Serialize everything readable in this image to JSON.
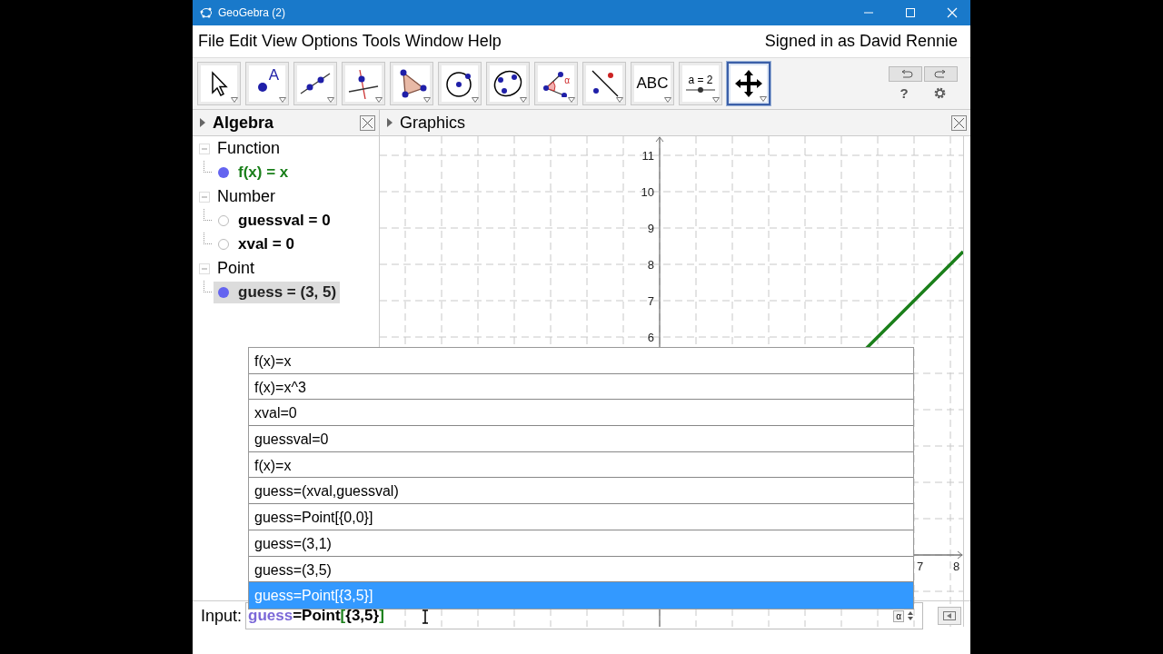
{
  "window": {
    "title": "GeoGebra (2)"
  },
  "menu": [
    "File",
    "Edit",
    "View",
    "Options",
    "Tools",
    "Window",
    "Help"
  ],
  "signed_in": "Signed in as David Rennie",
  "tools": [
    {
      "kind": "move",
      "selected": false
    },
    {
      "kind": "point",
      "label": "A",
      "selected": false
    },
    {
      "kind": "line",
      "selected": false
    },
    {
      "kind": "perpendicular",
      "selected": false
    },
    {
      "kind": "polygon",
      "selected": false
    },
    {
      "kind": "circle",
      "selected": false
    },
    {
      "kind": "conic",
      "selected": false
    },
    {
      "kind": "angle",
      "label": "α",
      "selected": false
    },
    {
      "kind": "reflect",
      "selected": false
    },
    {
      "kind": "text",
      "label": "ABC",
      "selected": false
    },
    {
      "kind": "slider",
      "label": "a = 2",
      "selected": false
    },
    {
      "kind": "move-view",
      "selected": true
    }
  ],
  "help": "?",
  "algebra": {
    "title": "Algebra",
    "groups": [
      {
        "name": "Function",
        "expanded": true,
        "children": [
          {
            "text": "f(x) = x",
            "shown": true,
            "color": "#1a7f1a",
            "selected": false
          }
        ]
      },
      {
        "name": "Number",
        "expanded": true,
        "children": [
          {
            "text": "guessval = 0",
            "shown": false,
            "color": "#000000",
            "selected": false
          },
          {
            "text": "xval = 0",
            "shown": false,
            "color": "#000000",
            "selected": false
          }
        ]
      },
      {
        "name": "Point",
        "expanded": true,
        "children": [
          {
            "text": "guess = (3, 5)",
            "shown": true,
            "color": "#222222",
            "selected": true
          }
        ]
      }
    ]
  },
  "graphics": {
    "title": "Graphics",
    "y_labels": [
      "11",
      "10",
      "9",
      "8",
      "7",
      "6"
    ],
    "x_labels": [
      "7",
      "8"
    ]
  },
  "history": [
    {
      "text": "f(x)=x",
      "selected": false
    },
    {
      "text": "f(x)=x^3",
      "selected": false
    },
    {
      "text": "xval=0",
      "selected": false
    },
    {
      "text": "guessval=0",
      "selected": false
    },
    {
      "text": "f(x)=x",
      "selected": false
    },
    {
      "text": "guess=(xval,guessval)",
      "selected": false
    },
    {
      "text": "guess=Point[{0,0}]",
      "selected": false
    },
    {
      "text": "guess=(3,1)",
      "selected": false
    },
    {
      "text": "guess=(3,5)",
      "selected": false
    },
    {
      "text": "guess=Point[{3,5}]",
      "selected": true
    }
  ],
  "input": {
    "label": "Input:",
    "value": [
      {
        "text": "guess",
        "color": "#7b68d8"
      },
      {
        "text": "=Point",
        "color": "#000000"
      },
      {
        "text": "[",
        "color": "#1a7f1a"
      },
      {
        "text": "{3,5}",
        "color": "#000000"
      },
      {
        "text": "]",
        "color": "#1a7f1a"
      }
    ],
    "symbol_button": "α"
  }
}
